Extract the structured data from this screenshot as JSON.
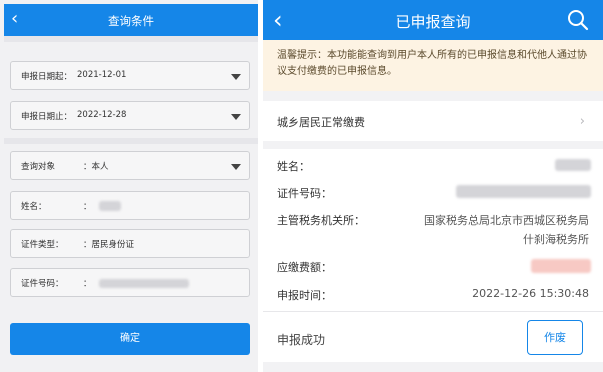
{
  "query_panel": {
    "title": "查询条件",
    "fields": {
      "start_date": {
        "label": "申报日期起：",
        "value": "2021-12-01"
      },
      "end_date": {
        "label": "申报日期止：",
        "value": "2022-12-28"
      },
      "target": {
        "label": "查询对象",
        "value": "：本人"
      },
      "name": {
        "label": "姓名：",
        "value": "："
      },
      "id_type": {
        "label": "证件类型：",
        "value": "：居民身份证"
      },
      "id_number": {
        "label": "证件号码：",
        "value": "："
      }
    },
    "confirm_label": "确定"
  },
  "result_panel": {
    "title": "已申报查询",
    "notice": "温馨提示：本功能能查询到用户本人所有的已申报信息和代他人通过协议支付缴费的已申报信息。",
    "category": "城乡居民正常缴费",
    "details": {
      "name_label": "姓名：",
      "id_label": "证件号码：",
      "authority_label": "主管税务机关所：",
      "authority_value_line1": "国家税务总局北京市西城区税务局",
      "authority_value_line2": "什刹海税务所",
      "amount_label": "应缴费额：",
      "time_label": "申报时间：",
      "time_value": "2022-12-26 15:30:48"
    },
    "status": "申报成功",
    "void_label": "作废"
  },
  "colors": {
    "brand_blue": "#1586e8",
    "notice_bg": "#fdf3e3"
  },
  "icons": {
    "back": "back-chevron-icon",
    "search": "search-icon",
    "caret": "dropdown-caret-icon",
    "row_chevron": "chevron-right-icon"
  }
}
